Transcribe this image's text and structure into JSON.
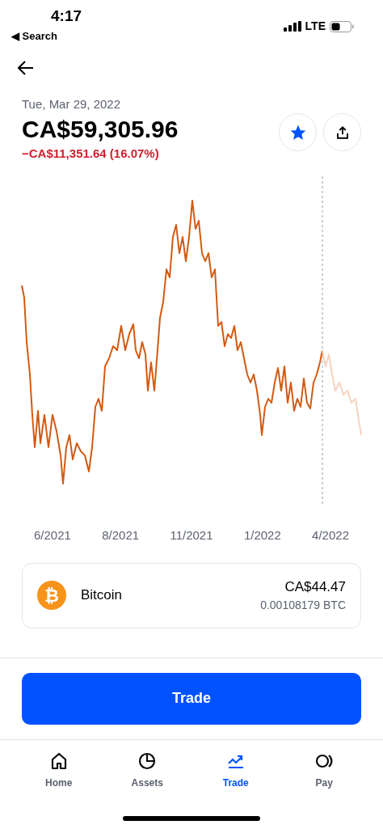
{
  "status_bar": {
    "time": "4:17",
    "back_label": "◀ Search",
    "network": "LTE"
  },
  "header": {
    "date": "Tue, Mar 29, 2022",
    "price": "CA$59,305.96",
    "change": "−CA$11,351.64 (16.07%)",
    "favorite": true
  },
  "chart": {
    "x_labels": [
      "6/2021",
      "8/2021",
      "11/2021",
      "1/2022",
      "4/2022"
    ]
  },
  "holding": {
    "symbol": "₿",
    "name": "Bitcoin",
    "value": "CA$44.47",
    "amount": "0.00108179 BTC"
  },
  "trade_button": "Trade",
  "nav": [
    {
      "kind": "home",
      "label": "Home",
      "selected": false
    },
    {
      "kind": "assets",
      "label": "Assets",
      "selected": false
    },
    {
      "kind": "trade",
      "label": "Trade",
      "selected": true
    },
    {
      "kind": "pay",
      "label": "Pay",
      "selected": false
    }
  ]
}
